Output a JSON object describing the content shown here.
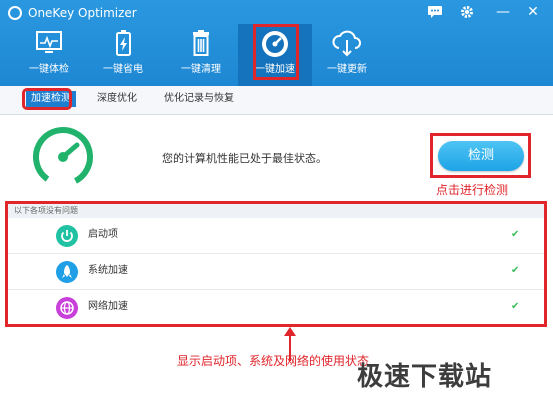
{
  "window": {
    "title": "OneKey Optimizer"
  },
  "title_buttons": [
    {
      "icon": "message-icon"
    },
    {
      "icon": "gear-icon"
    },
    {
      "icon": "minimize-icon",
      "glyph": "—"
    },
    {
      "icon": "close-icon",
      "glyph": "✕"
    }
  ],
  "toolbar": [
    {
      "label": "一键体检",
      "icon": "monitor-icon"
    },
    {
      "label": "一键省电",
      "icon": "battery-icon"
    },
    {
      "label": "一键清理",
      "icon": "trash-icon"
    },
    {
      "label": "一键加速",
      "icon": "speedometer-icon"
    },
    {
      "label": "一键更新",
      "icon": "cloud-download-icon"
    }
  ],
  "tabs": [
    "加速检测",
    "深度优化",
    "优化记录与恢复"
  ],
  "status": {
    "message": "您的计算机性能已处于最佳状态。"
  },
  "detect_button": {
    "label": "检测"
  },
  "annotations": {
    "click_detect": "点击进行检测",
    "show_status": "显示启动项、系统及网络的使用状态"
  },
  "list": {
    "header": "以下各项没有问题",
    "items": [
      {
        "label": "启动项",
        "icon": "power-icon",
        "color": "#20c2a3",
        "check": "✔"
      },
      {
        "label": "系统加速",
        "icon": "rocket-icon",
        "color": "#1e9fe6",
        "check": "✔"
      },
      {
        "label": "网络加速",
        "icon": "globe-icon",
        "color": "#c93fd9",
        "check": "✔"
      }
    ]
  },
  "watermark": "极速下载站",
  "colors": {
    "accent": "#1e87d3",
    "annotation": "#e0252b",
    "ok": "#3bbd5c",
    "gauge": "#21b36b"
  }
}
